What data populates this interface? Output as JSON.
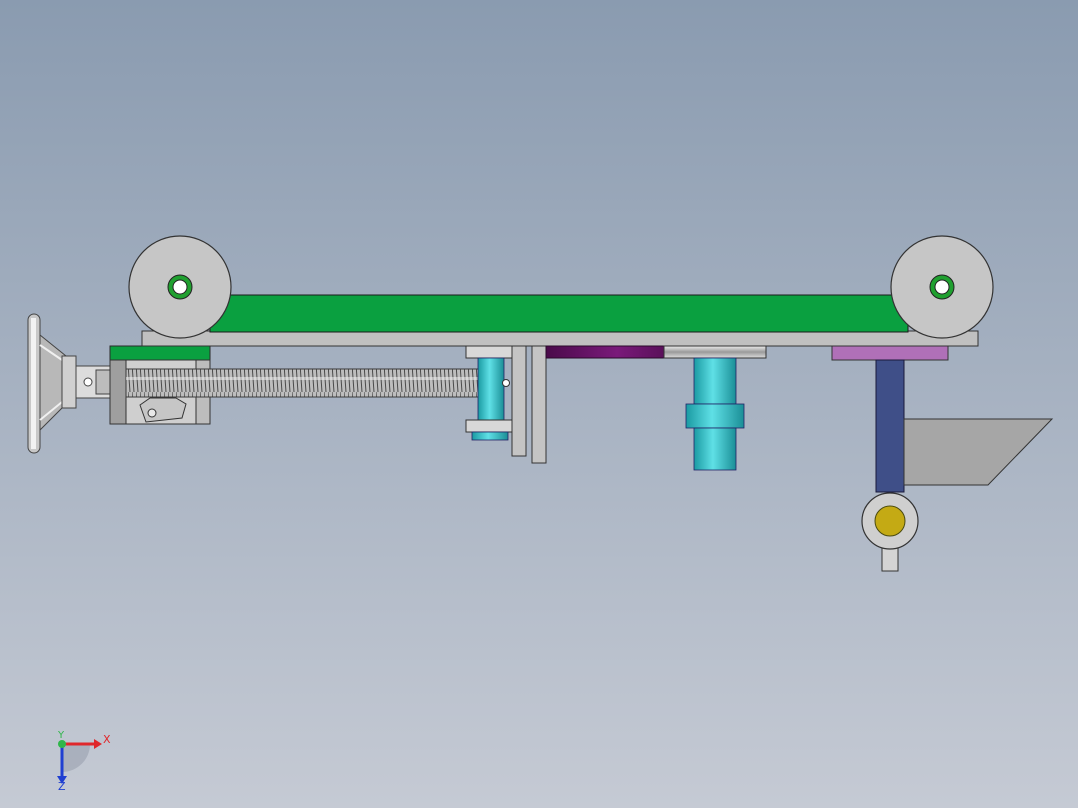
{
  "viewport": {
    "background_top": "#8a9bb0",
    "background_bottom": "#c5cad4"
  },
  "triad": {
    "x_label": "X",
    "y_label": "Y",
    "z_label": "Z",
    "x_color": "#e0272b",
    "y_color": "#2fb64a",
    "z_color": "#1f3fd1"
  },
  "colors": {
    "belt": "#0aa040",
    "frame": "#c0c0c0",
    "edge": "#3a3a3a",
    "cyan": "#2ec4cc",
    "purple": "#5c0f5c",
    "lilac": "#b070b8",
    "navy": "#3f4f88",
    "gold": "#c4aa14",
    "pulley_hub": "#20a030"
  }
}
